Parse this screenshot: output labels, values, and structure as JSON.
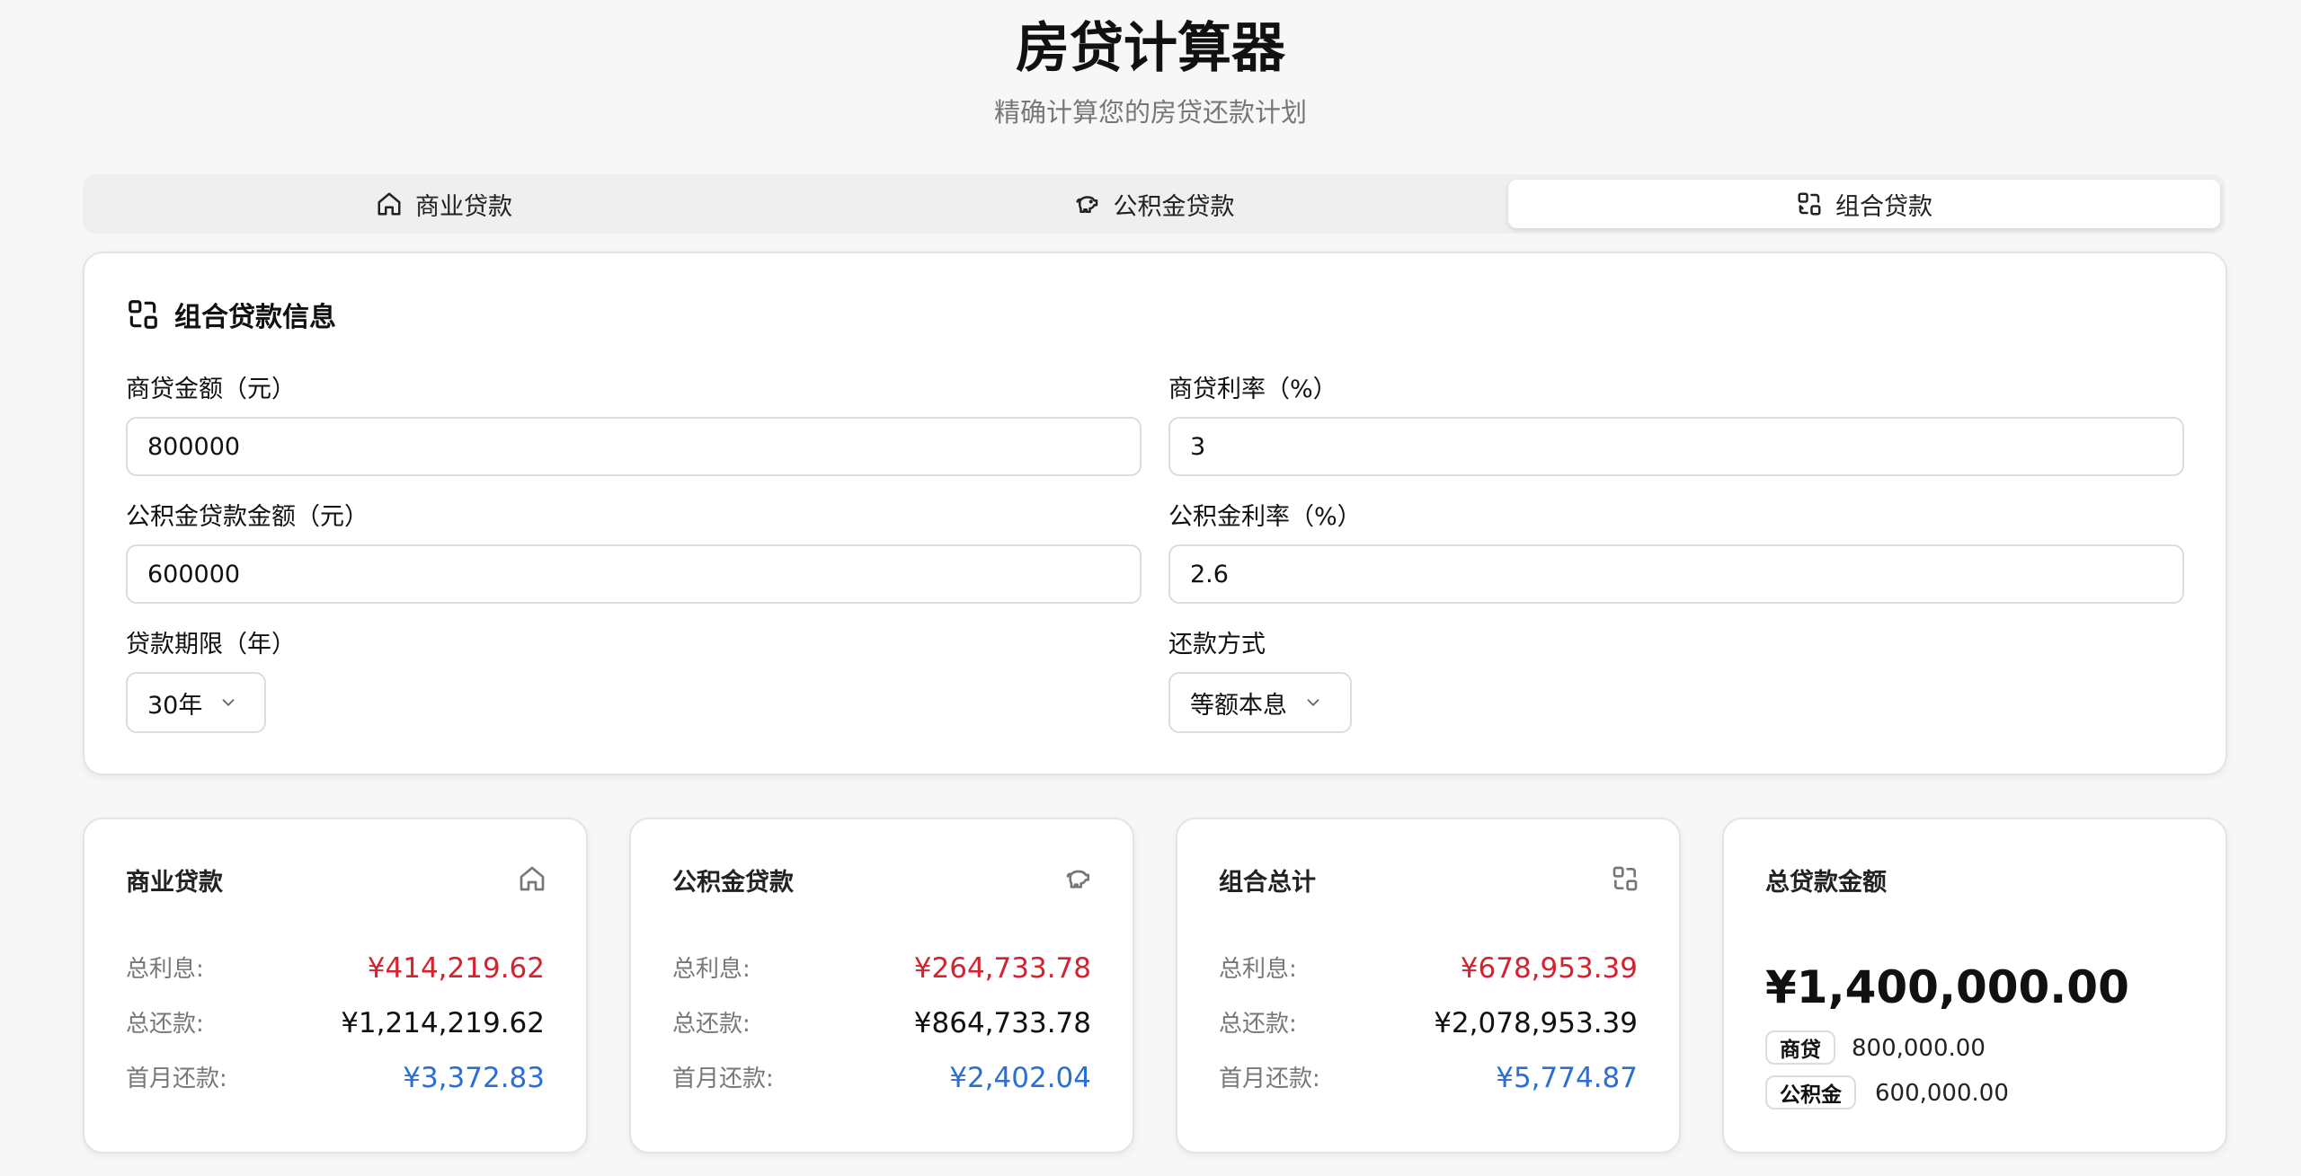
{
  "header": {
    "title": "房贷计算器",
    "subtitle": "精确计算您的房贷还款计划"
  },
  "tabs": [
    {
      "label": "商业贷款",
      "icon": "home-icon",
      "active": false
    },
    {
      "label": "公积金贷款",
      "icon": "piggy-bank-icon",
      "active": false
    },
    {
      "label": "组合贷款",
      "icon": "combine-icon",
      "active": true
    }
  ],
  "form": {
    "title": "组合贷款信息",
    "commercial_amount": {
      "label": "商贷金额（元）",
      "value": "800000"
    },
    "commercial_rate": {
      "label": "商贷利率（%）",
      "value": "3"
    },
    "fund_amount": {
      "label": "公积金贷款金额（元）",
      "value": "600000"
    },
    "fund_rate": {
      "label": "公积金利率（%）",
      "value": "2.6"
    },
    "term": {
      "label": "贷款期限（年）",
      "value": "30年"
    },
    "method": {
      "label": "还款方式",
      "value": "等额本息"
    }
  },
  "results": {
    "commercial": {
      "title": "商业贷款",
      "interest_label": "总利息:",
      "interest": "¥414,219.62",
      "total_label": "总还款:",
      "total": "¥1,214,219.62",
      "first_label": "首月还款:",
      "first": "¥3,372.83"
    },
    "fund": {
      "title": "公积金贷款",
      "interest_label": "总利息:",
      "interest": "¥264,733.78",
      "total_label": "总还款:",
      "total": "¥864,733.78",
      "first_label": "首月还款:",
      "first": "¥2,402.04"
    },
    "combined": {
      "title": "组合总计",
      "interest_label": "总利息:",
      "interest": "¥678,953.39",
      "total_label": "总还款:",
      "total": "¥2,078,953.39",
      "first_label": "首月还款:",
      "first": "¥5,774.87"
    },
    "total_loan": {
      "title": "总贷款金额",
      "amount": "¥1,400,000.00",
      "commercial_badge": "商贷",
      "commercial_value": "800,000.00",
      "fund_badge": "公积金",
      "fund_value": "600,000.00"
    }
  },
  "colors": {
    "interest": "#d6212f",
    "first_payment": "#2c6ed8",
    "background": "#f7f7f8"
  }
}
